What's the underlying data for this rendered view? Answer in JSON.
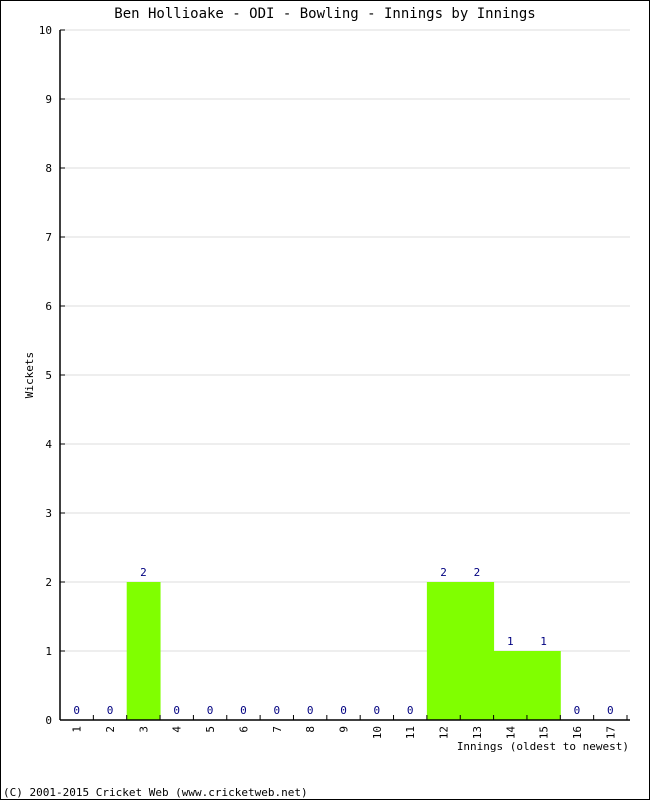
{
  "chart_data": {
    "type": "bar",
    "title": "Ben Hollioake - ODI - Bowling - Innings by Innings",
    "xlabel": "Innings (oldest to newest)",
    "ylabel": "Wickets",
    "categories": [
      "1",
      "2",
      "3",
      "4",
      "5",
      "6",
      "7",
      "8",
      "9",
      "10",
      "11",
      "12",
      "13",
      "14",
      "15",
      "16",
      "17"
    ],
    "values": [
      0,
      0,
      2,
      0,
      0,
      0,
      0,
      0,
      0,
      0,
      0,
      2,
      2,
      1,
      1,
      0,
      0
    ],
    "ylim": [
      0,
      10
    ],
    "yticks": [
      0,
      1,
      2,
      3,
      4,
      5,
      6,
      7,
      8,
      9,
      10
    ],
    "grid": true,
    "bar_color": "#80ff00",
    "label_color": "#000080"
  },
  "footer": "(C) 2001-2015 Cricket Web (www.cricketweb.net)"
}
